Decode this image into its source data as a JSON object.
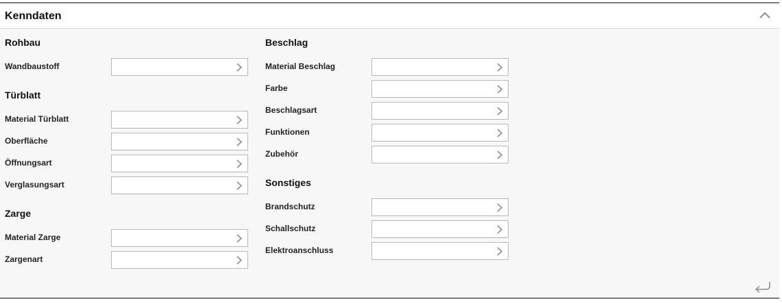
{
  "panel": {
    "title": "Kenndaten",
    "collapse_icon": "chevron-up-icon",
    "footer_icon": "return-arrow-icon"
  },
  "sections": {
    "rohbau": {
      "title": "Rohbau",
      "fields": [
        {
          "label": "Wandbaustoff",
          "value": ""
        }
      ]
    },
    "tuerblatt": {
      "title": "Türblatt",
      "fields": [
        {
          "label": "Material Türblatt",
          "value": ""
        },
        {
          "label": "Oberfläche",
          "value": ""
        },
        {
          "label": "Öffnungsart",
          "value": ""
        },
        {
          "label": "Verglasungsart",
          "value": ""
        }
      ]
    },
    "zarge": {
      "title": "Zarge",
      "fields": [
        {
          "label": "Material Zarge",
          "value": ""
        },
        {
          "label": "Zargenart",
          "value": ""
        }
      ]
    },
    "beschlag": {
      "title": "Beschlag",
      "fields": [
        {
          "label": "Material Beschlag",
          "value": ""
        },
        {
          "label": "Farbe",
          "value": ""
        },
        {
          "label": "Beschlagsart",
          "value": ""
        },
        {
          "label": "Funktionen",
          "value": ""
        },
        {
          "label": "Zubehör",
          "value": ""
        }
      ]
    },
    "sonstiges": {
      "title": "Sonstiges",
      "fields": [
        {
          "label": "Brandschutz",
          "value": ""
        },
        {
          "label": "Schallschutz",
          "value": ""
        },
        {
          "label": "Elektroanschluss",
          "value": ""
        }
      ]
    }
  },
  "colors": {
    "panel_background": "#f7f7f7",
    "border": "#7a7a7a",
    "input_border": "#b9b9b9",
    "icon": "#8c8c8c"
  }
}
